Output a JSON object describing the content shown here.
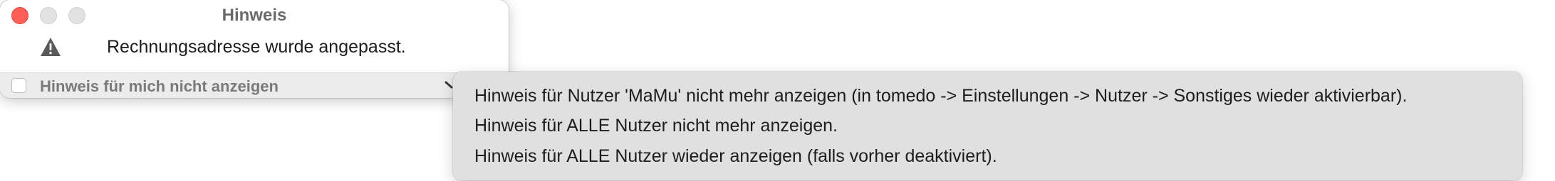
{
  "window": {
    "title": "Hinweis"
  },
  "message": {
    "icon": "warning-icon",
    "text": "Rechnungsadresse wurde angepasst."
  },
  "footer": {
    "checkbox_label": "Hinweis für mich nicht anzeigen",
    "checkbox_checked": false
  },
  "menu": {
    "items": [
      "Hinweis für Nutzer 'MaMu' nicht mehr anzeigen (in tomedo -> Einstellungen -> Nutzer -> Sonstiges wieder aktivierbar).",
      "Hinweis für ALLE Nutzer nicht mehr anzeigen.",
      "Hinweis für ALLE Nutzer wieder anzeigen (falls vorher deaktiviert)."
    ]
  },
  "colors": {
    "close_button": "#ff5f57",
    "menu_background": "#e0e0e0"
  }
}
